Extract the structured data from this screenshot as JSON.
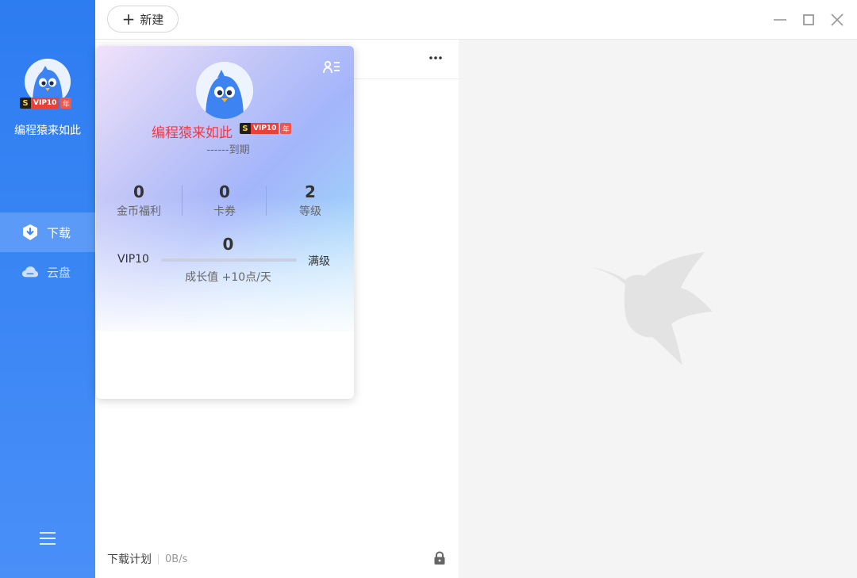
{
  "sidebar": {
    "username": "编程猿来如此",
    "vip_badge": {
      "s": "S",
      "vip": "VIP10",
      "year": "年"
    },
    "nav": [
      {
        "label": "下载",
        "icon": "download-shield-icon",
        "active": true
      },
      {
        "label": "云盘",
        "icon": "cloud-icon",
        "active": false
      }
    ]
  },
  "toolbar": {
    "new_label": "新建"
  },
  "popup": {
    "username": "编程猿来如此",
    "vip_badge": {
      "s": "S",
      "vip": "VIP10",
      "year": "年"
    },
    "expire": "------到期",
    "stats": [
      {
        "value": "0",
        "label": "金币福利"
      },
      {
        "value": "0",
        "label": "卡券"
      },
      {
        "value": "2",
        "label": "等级"
      }
    ],
    "level": {
      "current_value": "0",
      "left": "VIP10",
      "right": "满级",
      "progress": 0,
      "growth": "成长值 +10点/天"
    }
  },
  "footer": {
    "plan_label": "下载计划",
    "speed": "0B/s"
  },
  "colors": {
    "sidebar": "#2d7cf0",
    "username_red": "#ea3b4b",
    "right_panel": "#f4f4f4"
  }
}
